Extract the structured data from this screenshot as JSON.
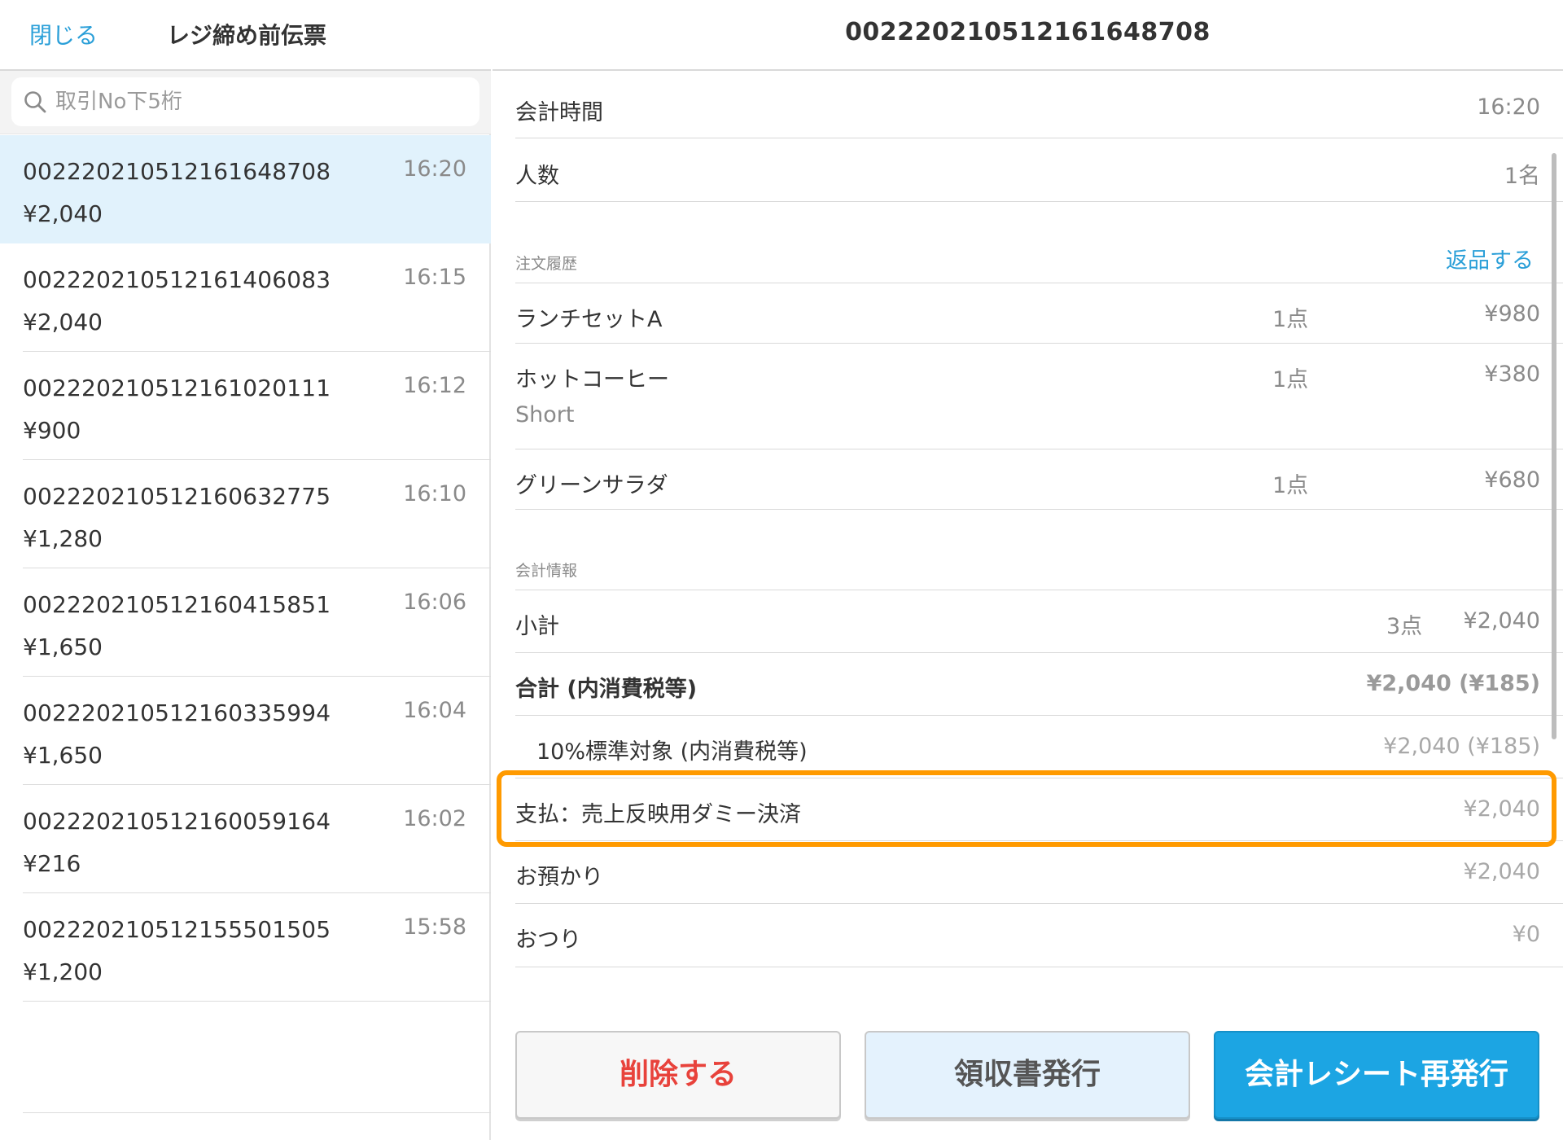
{
  "left_header": {
    "close_label": "閉じる",
    "title": "レジ締め前伝票"
  },
  "search": {
    "placeholder": "取引No下5桁",
    "value": ""
  },
  "slips": [
    {
      "no": "00222021051216164870​8",
      "amount": "¥2,040",
      "time": "16:20",
      "selected": true
    },
    {
      "no": "00222021051216140608​3",
      "amount": "¥2,040",
      "time": "16:15",
      "selected": false
    },
    {
      "no": "00222021051216102011​1",
      "amount": "¥900",
      "time": "16:12",
      "selected": false
    },
    {
      "no": "00222021051216063277​5",
      "amount": "¥1,280",
      "time": "16:10",
      "selected": false
    },
    {
      "no": "00222021051216041585​1",
      "amount": "¥1,650",
      "time": "16:06",
      "selected": false
    },
    {
      "no": "00222021051216033599​4",
      "amount": "¥1,650",
      "time": "16:04",
      "selected": false
    },
    {
      "no": "00222021051216005916​4",
      "amount": "¥216",
      "time": "16:02",
      "selected": false
    },
    {
      "no": "00222021051215550150​5",
      "amount": "¥1,200",
      "time": "15:58",
      "selected": false
    }
  ],
  "detail": {
    "title": "002220210512161648708",
    "checkout_time": {
      "label": "会計時間",
      "value": "16:20"
    },
    "guests": {
      "label": "人数",
      "value": "1名"
    },
    "order_history": {
      "label": "注文履歴",
      "return_label": "返品する",
      "items": [
        {
          "name": "ランチセットA",
          "option": "",
          "qty": "1点",
          "price": "¥980"
        },
        {
          "name": "ホットコーヒー",
          "option": "Short",
          "qty": "1点",
          "price": "¥380"
        },
        {
          "name": "グリーンサラダ",
          "option": "",
          "qty": "1点",
          "price": "¥680"
        }
      ]
    },
    "payment_info": {
      "label": "会計情報",
      "subtotal": {
        "label": "小計",
        "qty": "3点",
        "value": "¥2,040"
      },
      "total": {
        "label": "合計 (内消費税等)",
        "value": "¥2,040 (¥185)"
      },
      "tax10": {
        "label": "10%標準対象 (内消費税等)",
        "value": "¥2,040 (¥185)"
      },
      "payment": {
        "label": "支払：売上反映用ダミー決済",
        "value": "¥2,040"
      },
      "deposit": {
        "label": "お預かり",
        "value": "¥2,040"
      },
      "change": {
        "label": "おつり",
        "value": "¥0"
      }
    }
  },
  "buttons": {
    "delete": "削除する",
    "receipt": "領収書発行",
    "reissue": "会計レシート再発行"
  },
  "colors": {
    "accent_blue": "#2a9fd8",
    "selected_row": "#e1f2fc",
    "highlight_orange": "#ff9a00",
    "delete_red": "#e8423b",
    "primary_button": "#1ca5e3"
  },
  "icons": {
    "search": "search-icon"
  }
}
